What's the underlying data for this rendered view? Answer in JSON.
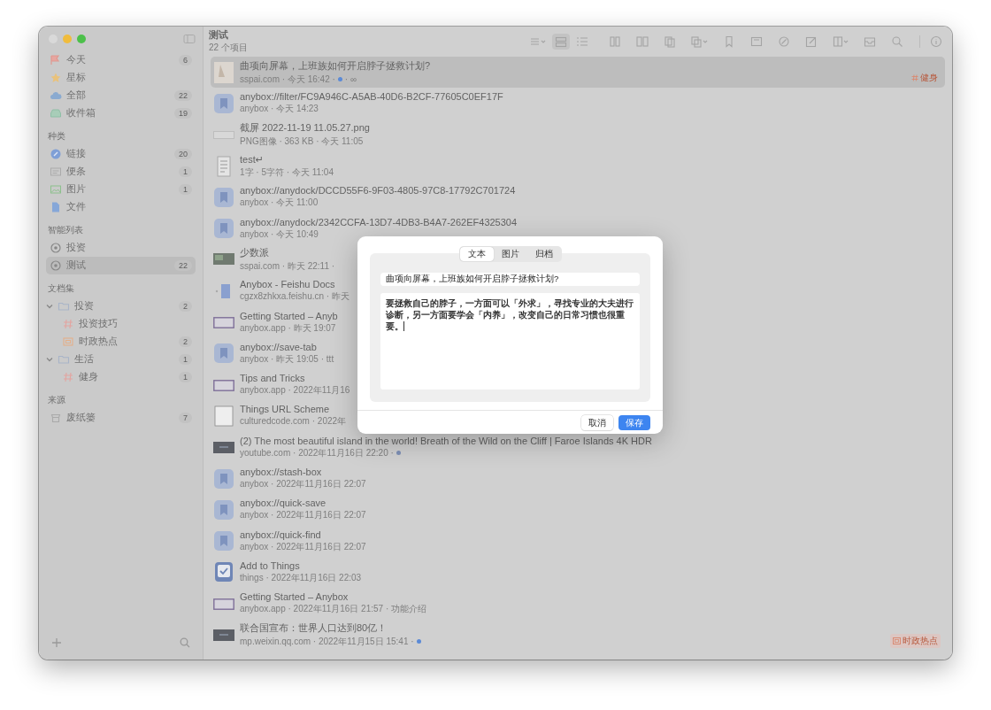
{
  "sidebar": {
    "sections": [
      {
        "items": [
          {
            "label": "今天",
            "count": "6",
            "kind": "flag",
            "selected": false
          },
          {
            "label": "星标",
            "kind": "star",
            "selected": false
          },
          {
            "label": "全部",
            "count": "22",
            "kind": "cloud",
            "selected": false
          },
          {
            "label": "收件箱",
            "count": "19",
            "kind": "tray",
            "selected": false
          }
        ]
      },
      {
        "heading": "种类",
        "items": [
          {
            "label": "链接",
            "count": "20",
            "kind": "link",
            "selected": false
          },
          {
            "label": "便条",
            "count": "1",
            "kind": "note",
            "selected": false
          },
          {
            "label": "图片",
            "count": "1",
            "kind": "image",
            "selected": false
          },
          {
            "label": "文件",
            "kind": "file",
            "selected": false
          }
        ]
      },
      {
        "heading": "智能列表",
        "items": [
          {
            "label": "投资",
            "kind": "smart",
            "selected": false
          },
          {
            "label": "测试",
            "count": "22",
            "kind": "smart",
            "selected": true
          }
        ]
      },
      {
        "heading": "文档集",
        "items": [
          {
            "label": "投资",
            "count": "2",
            "kind": "folder",
            "expanded": true,
            "selected": false,
            "children": [
              {
                "label": "投资技巧",
                "kind": "hash",
                "selected": false
              },
              {
                "label": "时政热点",
                "count": "2",
                "kind": "box",
                "selected": false
              }
            ]
          },
          {
            "label": "生活",
            "count": "1",
            "kind": "folder",
            "expanded": true,
            "selected": false,
            "children": [
              {
                "label": "健身",
                "count": "1",
                "kind": "hash",
                "selected": false
              }
            ]
          }
        ]
      },
      {
        "heading": "来源",
        "items": [
          {
            "label": "废纸篓",
            "count": "7",
            "kind": "trash",
            "selected": false
          }
        ]
      }
    ]
  },
  "list": {
    "title": "测试",
    "subtitle": "22 个项目",
    "view_modes": [
      {
        "selected": true
      },
      {
        "selected": false
      }
    ],
    "rows": [
      {
        "title": "曲项向屏幕，上班族如何开启脖子拯救计划?",
        "kind": "photo",
        "selected": true,
        "meta": [
          {
            "kind": "text",
            "text": "sspai.com · 今天 16:42 ·"
          },
          {
            "kind": "dot",
            "color": "#5b8ad6"
          },
          {
            "kind": "text",
            "text": "· ∞"
          }
        ],
        "tag": {
          "kind": "hash",
          "text": "健身"
        }
      },
      {
        "title": "anybox://filter/FC9A946C-A5AB-40D6-B2CF-77605C0EF17F",
        "kind": "app",
        "selected": false,
        "meta": [
          {
            "kind": "text",
            "text": "anybox · 今天 14:23"
          }
        ]
      },
      {
        "title": "截屏 2022-11-19 11.05.27.png",
        "kind": "screenshot",
        "selected": false,
        "meta": [
          {
            "kind": "text",
            "text": "PNG图像 · 363 KB · 今天 11:05"
          }
        ]
      },
      {
        "title": "test↵",
        "kind": "note",
        "selected": false,
        "meta": [
          {
            "kind": "text",
            "text": "1字 · 5字符 · 今天 11:04"
          }
        ]
      },
      {
        "title": "anybox://anydock/DCCD55F6-9F03-4805-97C8-17792C701724",
        "kind": "app",
        "selected": false,
        "meta": [
          {
            "kind": "text",
            "text": "anybox · 今天 11:00"
          }
        ]
      },
      {
        "title": "anybox://anydock/2342CCFA-13D7-4DB3-B4A7-262EF4325304",
        "kind": "app",
        "selected": false,
        "meta": [
          {
            "kind": "text",
            "text": "anybox · 今天 10:49"
          }
        ]
      },
      {
        "title": "少数派",
        "kind": "wide",
        "selected": false,
        "meta": [
          {
            "kind": "text",
            "text": "sspai.com · 昨天 22:11 ·"
          }
        ]
      },
      {
        "title": "Anybox - Feishu Docs",
        "kind": "doc",
        "selected": false,
        "meta": [
          {
            "kind": "text",
            "text": "cgzx8zhkxa.feishu.cn · 昨天"
          }
        ]
      },
      {
        "title": "Getting Started – Anyb",
        "kind": "web",
        "selected": false,
        "meta": [
          {
            "kind": "text",
            "text": "anybox.app · 昨天 19:07"
          }
        ]
      },
      {
        "title": "anybox://save-tab",
        "kind": "app",
        "selected": false,
        "meta": [
          {
            "kind": "text",
            "text": "anybox · 昨天 19:05 · ttt"
          }
        ]
      },
      {
        "title": "Tips and Tricks",
        "kind": "web",
        "selected": false,
        "meta": [
          {
            "kind": "text",
            "text": "anybox.app · 2022年11月16"
          }
        ]
      },
      {
        "title": "Things URL Scheme",
        "kind": "page",
        "selected": false,
        "meta": [
          {
            "kind": "text",
            "text": "culturedcode.com · 2022年"
          }
        ]
      },
      {
        "title": "(2) The most beautiful island in the world! Breath of the Wild on the Cliff | Faroe Islands 4K HDR",
        "kind": "dark",
        "selected": false,
        "meta": [
          {
            "kind": "text",
            "text": "youtube.com · 2022年11月16日 22:20 ·"
          },
          {
            "kind": "dot",
            "color": "#7d8fb5"
          }
        ]
      },
      {
        "title": "anybox://stash-box",
        "kind": "app",
        "selected": false,
        "meta": [
          {
            "kind": "text",
            "text": "anybox · 2022年11月16日 22:07"
          }
        ]
      },
      {
        "title": "anybox://quick-save",
        "kind": "app",
        "selected": false,
        "meta": [
          {
            "kind": "text",
            "text": "anybox · 2022年11月16日 22:07"
          }
        ]
      },
      {
        "title": "anybox://quick-find",
        "kind": "app",
        "selected": false,
        "meta": [
          {
            "kind": "text",
            "text": "anybox · 2022年11月16日 22:07"
          }
        ]
      },
      {
        "title": "Add to Things",
        "kind": "things",
        "selected": false,
        "meta": [
          {
            "kind": "text",
            "text": "things · 2022年11月16日 22:03"
          }
        ]
      },
      {
        "title": "Getting Started – Anybox",
        "kind": "web",
        "selected": false,
        "meta": [
          {
            "kind": "text",
            "text": "anybox.app · 2022年11月16日 21:57 · 功能介绍"
          }
        ]
      },
      {
        "title": "联合国宣布：世界人口达到80亿！",
        "kind": "dark",
        "selected": false,
        "meta": [
          {
            "kind": "text",
            "text": "mp.weixin.qq.com · 2022年11月15日 15:41 ·"
          },
          {
            "kind": "dot",
            "color": "#5b8ad6"
          }
        ],
        "tag": {
          "kind": "box",
          "text": "时政热点"
        }
      }
    ]
  },
  "dialog": {
    "tabs": [
      {
        "label": "文本",
        "selected": true
      },
      {
        "label": "图片",
        "selected": false
      },
      {
        "label": "归档",
        "selected": false
      }
    ],
    "title_value": "曲项向屏幕，上班族如何开启脖子拯救计划?",
    "body_value": "要拯救自己的脖子，一方面可以「外求」，寻找专业的大夫进行诊断，另一方面要学会「内养」，改变自己的日常习惯也很重要。",
    "buttons": [
      {
        "label": "取消",
        "kind": "secondary"
      },
      {
        "label": "保存",
        "kind": "primary"
      }
    ]
  }
}
